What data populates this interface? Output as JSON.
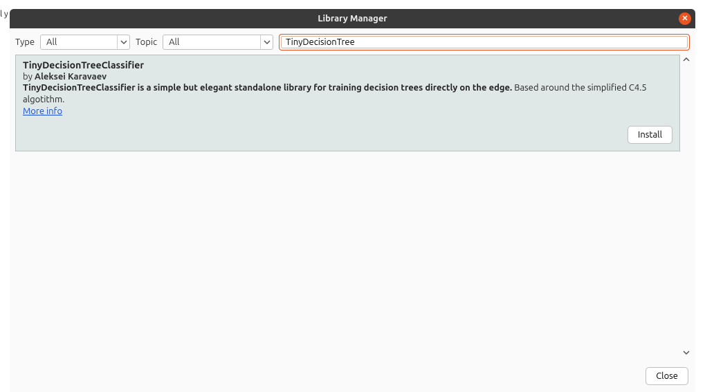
{
  "edge_text": "l y",
  "window": {
    "title": "Library Manager"
  },
  "filters": {
    "type_label": "Type",
    "type_value": "All",
    "topic_label": "Topic",
    "topic_value": "All",
    "search_value": "TinyDecisionTree"
  },
  "result": {
    "title": "TinyDecisionTreeClassifier",
    "by_prefix": "by ",
    "author": "Aleksei Karavaev",
    "desc_bold": "TinyDecisionTreeClassifier is a simple but elegant standalone library for training decision trees directly on the edge.",
    "desc_rest": " Based around the simplified C4.5 algotithm.",
    "more_info": "More info",
    "install_label": "Install"
  },
  "footer": {
    "close_label": "Close"
  }
}
